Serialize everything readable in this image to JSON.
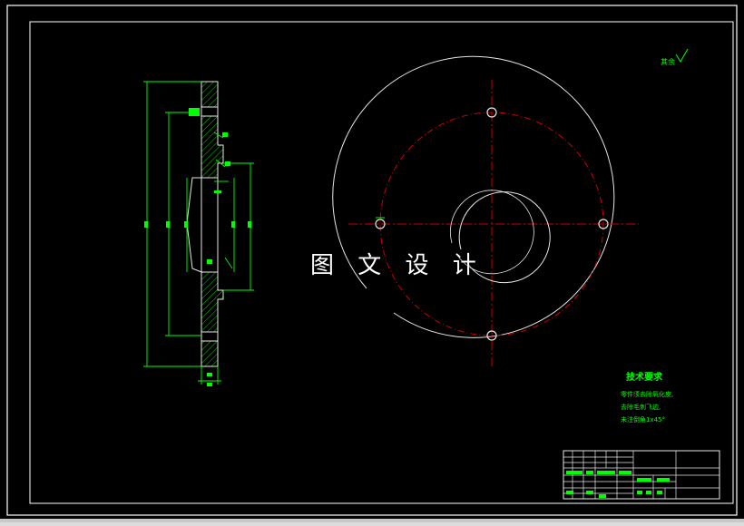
{
  "colors": {
    "background": "#000000",
    "frame": "#ffffff",
    "part_lines": "#e6e6e6",
    "dimension": "#00ff00",
    "centerline": "#cc0000",
    "annotation": "#00ff00"
  },
  "watermark": {
    "text": "图 文 设 计"
  },
  "roughness_note": {
    "text": "其余"
  },
  "tech_requirements": {
    "title": "技术要求",
    "lines": [
      "零件须去除氧化皮,",
      "去除毛刺飞边,",
      "未注倒角1x45°"
    ]
  },
  "title_block": {
    "present": true
  },
  "views": {
    "side_section": "side-section-view",
    "front": "front-view"
  }
}
